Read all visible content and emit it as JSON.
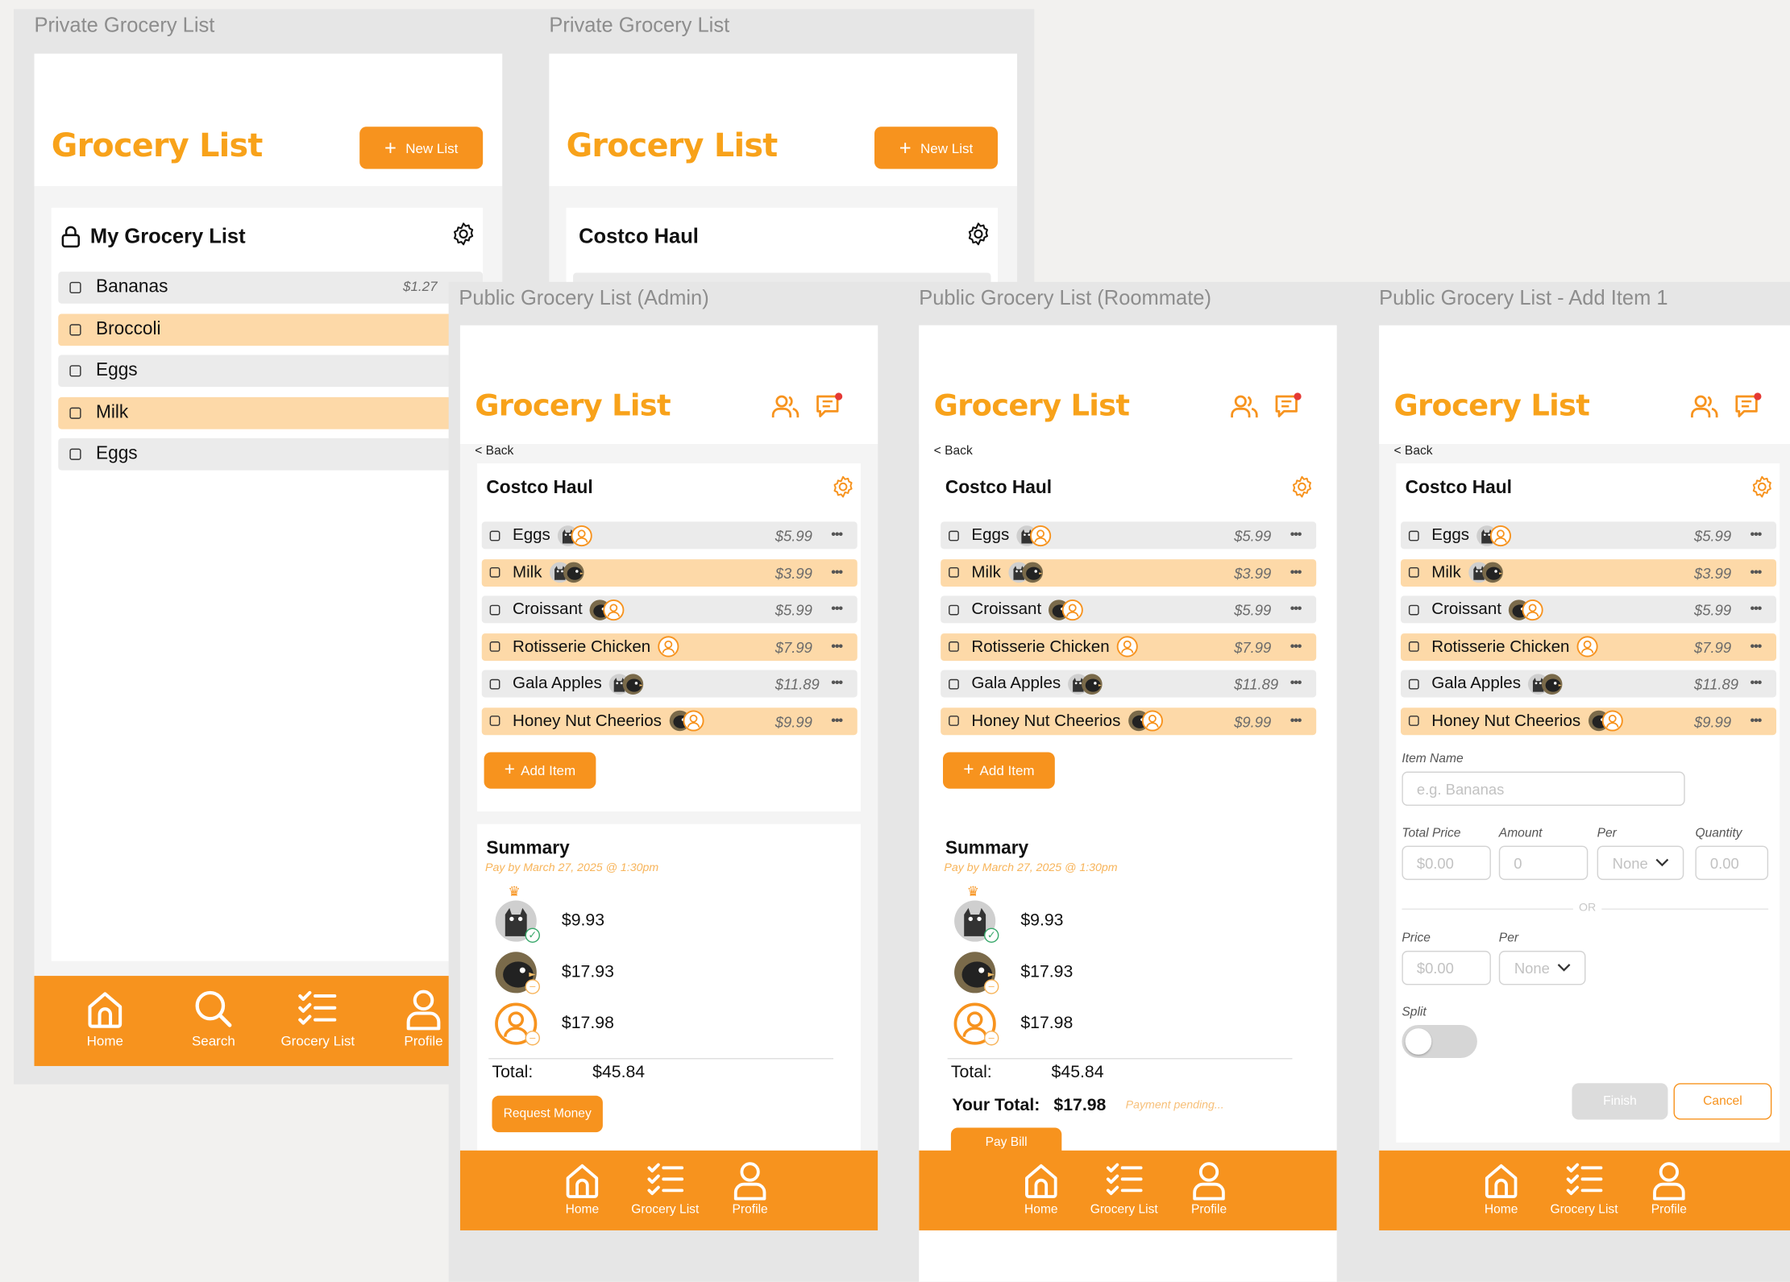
{
  "brand_color": "#f8a21a",
  "accent_color": "#f7931e",
  "row_highlight_color": "#fdd9a8",
  "frames": {
    "private1": "Private Grocery List",
    "private2": "Private Grocery List",
    "admin": "Public Grocery List (Admin)",
    "roommate": "Public Grocery List (Roommate)",
    "additem": "Public Grocery List - Add Item 1"
  },
  "app_title": "Grocery List",
  "new_list_label": "New List",
  "back_label": "< Back",
  "private_list": {
    "title": "My Grocery List",
    "items": [
      {
        "name": "Bananas",
        "price": "$1.27"
      },
      {
        "name": "Broccoli",
        "price": ""
      },
      {
        "name": "Eggs",
        "price": ""
      },
      {
        "name": "Milk",
        "price": ""
      },
      {
        "name": "Eggs",
        "price": ""
      }
    ]
  },
  "costco_title": "Costco Haul",
  "public_items": [
    {
      "name": "Eggs",
      "price": "$5.99",
      "avatars": [
        "cat-avatar",
        "person-avatar"
      ]
    },
    {
      "name": "Milk",
      "price": "$3.99",
      "avatars": [
        "cat-avatar",
        "bird-avatar"
      ]
    },
    {
      "name": "Croissant",
      "price": "$5.99",
      "avatars": [
        "bird-avatar",
        "person-avatar"
      ]
    },
    {
      "name": "Rotisserie Chicken",
      "price": "$7.99",
      "avatars": [
        "person-avatar"
      ]
    },
    {
      "name": "Gala Apples",
      "price": "$11.89",
      "avatars": [
        "cat-avatar",
        "bird-avatar"
      ]
    },
    {
      "name": "Honey Nut Cheerios",
      "price": "$9.99",
      "avatars": [
        "bird-avatar",
        "person-avatar"
      ]
    }
  ],
  "add_item_label": "Add Item",
  "summary": {
    "title": "Summary",
    "pay_by": "Pay by March 27, 2025 @ 1:30pm",
    "amounts": [
      "$9.93",
      "$17.93",
      "$17.98"
    ],
    "total_label": "Total:",
    "total_value": "$45.84",
    "request_money": "Request Money",
    "your_total_label": "Your Total:",
    "your_total_value": "$17.98",
    "payment_pending": "Payment pending...",
    "pay_bill": "Pay Bill"
  },
  "nav": {
    "home": "Home",
    "search": "Search",
    "grocery_list": "Grocery List",
    "profile": "Profile"
  },
  "add_form": {
    "item_name_label": "Item Name",
    "item_name_placeholder": "e.g. Bananas",
    "total_price_label": "Total Price",
    "total_price_placeholder": "$0.00",
    "amount_label": "Amount",
    "amount_placeholder": "0",
    "per_label": "Per",
    "per_value": "None",
    "quantity_label": "Quantity",
    "quantity_placeholder": "0.00",
    "or_label": "OR",
    "price_label": "Price",
    "price_placeholder": "$0.00",
    "per2_label": "Per",
    "per2_value": "None",
    "split_label": "Split",
    "finish_label": "Finish",
    "cancel_label": "Cancel"
  }
}
